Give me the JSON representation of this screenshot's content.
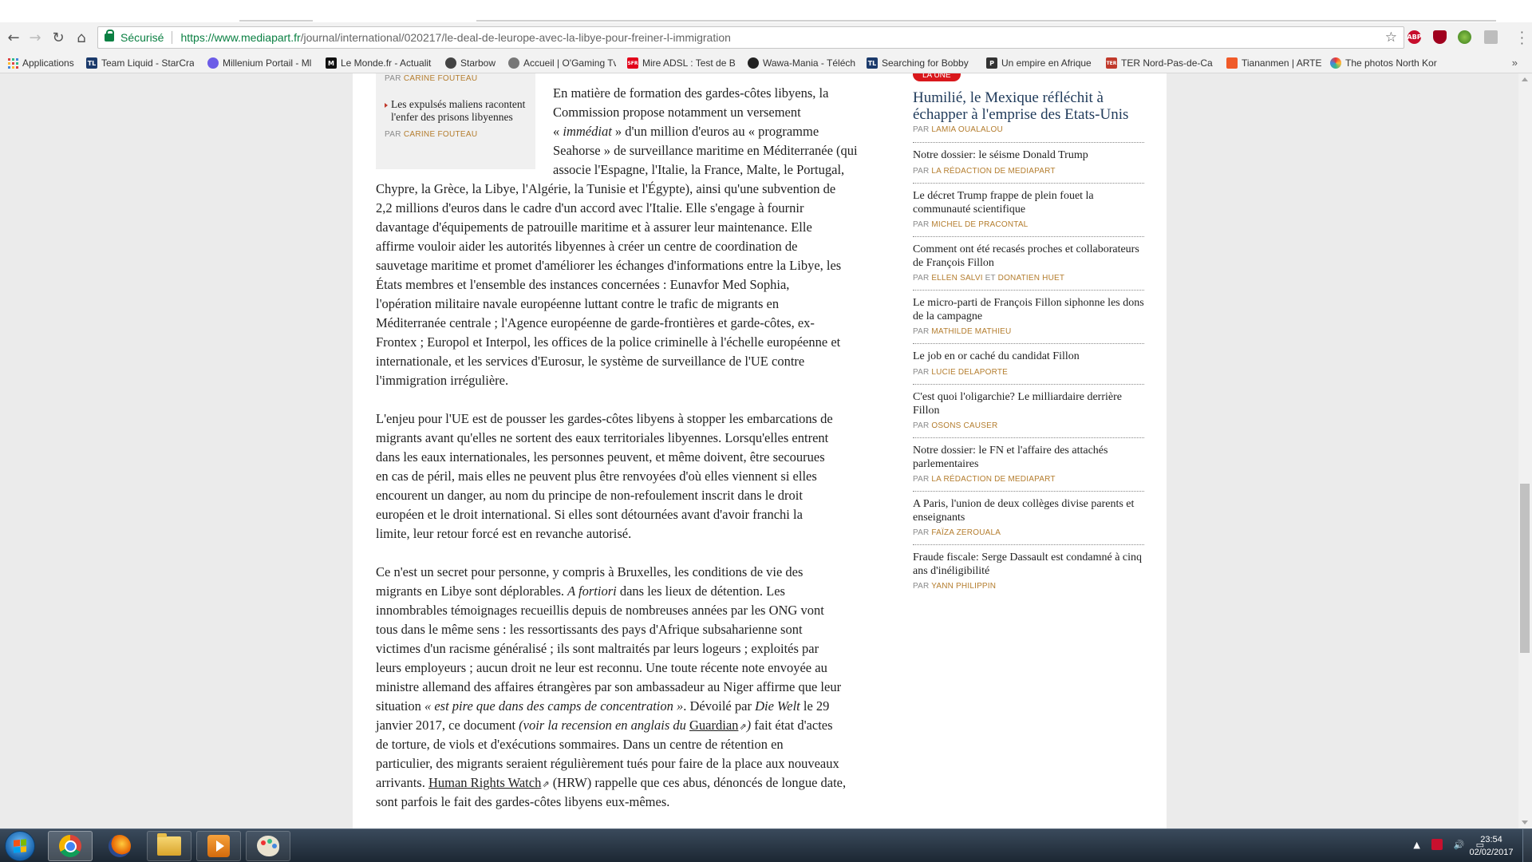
{
  "browser": {
    "secure_label": "Sécurisé",
    "url_host": "https://www.mediapart.fr",
    "url_path": "/journal/international/020217/le-deal-de-leurope-avec-la-libye-pour-freiner-l-immigration",
    "bookmarks": [
      {
        "label": "Applications",
        "icon": "apps-grid-icon",
        "color": "#555555"
      },
      {
        "label": "Team Liquid - StarCra",
        "icon": "tl-icon",
        "color": "#1b3a6b"
      },
      {
        "label": "Millenium Portail - Ml",
        "icon": "millenium-icon",
        "color": "#6c5ce7"
      },
      {
        "label": "Le Monde.fr - Actualit",
        "icon": "lemonde-icon",
        "color": "#111111"
      },
      {
        "label": "Starbow",
        "icon": "starbow-icon",
        "color": "#444444"
      },
      {
        "label": "Accueil | O'Gaming Tv",
        "icon": "ogaming-icon",
        "color": "#777777"
      },
      {
        "label": "Mire ADSL : Test de B",
        "icon": "sfr-icon",
        "color": "#e2001a"
      },
      {
        "label": "Wawa-Mania - Téléch",
        "icon": "wawa-icon",
        "color": "#222222"
      },
      {
        "label": "Searching for Bobby",
        "icon": "tl-icon",
        "color": "#1b3a6b"
      },
      {
        "label": "Un empire en Afrique",
        "icon": "page-icon",
        "color": "#333333"
      },
      {
        "label": "TER Nord-Pas-de-Cal",
        "icon": "ter-icon",
        "color": "#c0392b"
      },
      {
        "label": "Tiananmen | ARTE",
        "icon": "arte-icon",
        "color": "#f05a28"
      },
      {
        "label": "The photos North Kor",
        "icon": "photos-icon",
        "color": "#3c8dde"
      }
    ],
    "more_bookmarks": "»",
    "extensions": [
      {
        "name": "adblock-icon",
        "text": "ABP",
        "color": "#c70d2c"
      },
      {
        "name": "ublock-icon",
        "text": "",
        "color": "#a0001e"
      },
      {
        "name": "globe-ext-icon",
        "text": "",
        "color": "#5aa02c"
      },
      {
        "name": "pdf-ext-icon",
        "text": "",
        "color": "#b8b8b8"
      }
    ]
  },
  "related": {
    "top_by": "PAR",
    "top_author": "CARINE FOUTEAU",
    "title": "Les expulsés maliens racontent l'enfer des prisons libyennes",
    "by": "PAR",
    "author": "CARINE FOUTEAU"
  },
  "article": {
    "p1": [
      "En matière de formation des gardes-côtes libyens, la",
      "Commission propose notamment un versement",
      [
        "« ",
        "immédiat",
        " » d'un million d'euros au « programme"
      ],
      "Seahorse » de surveillance maritime en Méditerranée (qui",
      "associe l'Espagne, l'Italie, la France, Malte, le Portugal,",
      "Chypre, la Grèce, la Libye, l'Algérie, la Tunisie et l'Égypte), ainsi qu'une subvention de",
      "2,2 millions d'euros dans le cadre d'un accord avec l'Italie. Elle s'engage à fournir",
      "davantage d'équipements de patrouille maritime et à assurer leur maintenance. Elle",
      "affirme vouloir aider les autorités libyennes à créer un centre de coordination de",
      "sauvetage maritime et promet d'améliorer les échanges d'informations entre la Libye, les",
      "États membres et l'ensemble des instances concernées : Eunavfor Med Sophia,",
      "l'opération militaire navale européenne luttant contre le trafic de migrants en",
      "Méditerranée centrale ; l'Agence européenne de garde-frontières et garde-côtes, ex-",
      "Frontex ; Europol et Interpol, les offices de la police criminelle à l'échelle européenne et",
      "internationale, et les services d'Eurosur, le système de surveillance de l'UE contre",
      "l'immigration irrégulière."
    ],
    "p2": [
      "L'enjeu pour l'UE est de pousser les gardes-côtes libyens à stopper les embarcations de",
      "migrants avant qu'elles ne sortent des eaux territoriales libyennes. Lorsqu'elles entrent",
      "dans les eaux internationales, les personnes peuvent, et même doivent, être secourues",
      "en cas de péril, mais elles ne peuvent plus être renvoyées d'où elles viennent si elles",
      "encourent un danger, au nom du principe de non-refoulement inscrit dans le droit",
      "européen et le droit international. Si elles sont détournées avant d'avoir franchi la",
      "limite, leur retour forcé est en revanche autorisé."
    ],
    "p3": {
      "l1": "Ce n'est un secret pour personne, y compris à Bruxelles, les conditions de vie des",
      "l2a": "migrants en Libye sont déplorables. ",
      "l2b": "A fortiori",
      "l2c": " dans les lieux de détention. Les",
      "l3": "innombrables témoignages recueillis depuis de nombreuses années par les ONG vont",
      "l4": "tous dans le même sens : les ressortissants des pays d'Afrique subsaharienne sont",
      "l5": "victimes d'un racisme généralisé ; ils sont maltraités par leurs logeurs ; exploités par",
      "l6": "leurs employeurs ; aucun droit ne leur est reconnu. Une toute récente note envoyée au",
      "l7": "ministre allemand des affaires étrangères par son ambassadeur au Niger affirme que leur",
      "l8a": "situation ",
      "l8b": "« est pire que dans des camps de concentration »",
      "l8c": ". Dévoilé par ",
      "l8d": "Die Welt",
      "l8e": " le 29",
      "l9a": "janvier 2017, ce document ",
      "l9b": "(voir la recension en anglais du ",
      "l9c": "Guardian",
      "l9d": ")",
      "l9e": " fait état d'actes",
      "l10": "de torture, de viols et d'exécutions sommaires. Dans un centre de rétention en",
      "l11": "particulier, des migrants seraient régulièrement tués pour faire de la place aux nouveaux",
      "l12a": "arrivants. ",
      "l12b": "Human Rights Watch",
      "l12c": " (HRW) rappelle que ces abus, dénoncés de longue date,",
      "l13": "sont parfois le fait des gardes-côtes libyens eux-mêmes."
    }
  },
  "sidebar": {
    "badge": "LA UNE",
    "lead_title": "Humilié, le Mexique réfléchit à échapper à l'emprise des Etats-Unis",
    "lead_by": "PAR",
    "lead_author": "LAMIA OUALALOU",
    "items": [
      {
        "title": "Notre dossier: le séisme Donald Trump",
        "by": "PAR",
        "author": "LA RÉDACTION DE MEDIAPART"
      },
      {
        "title": "Le décret Trump frappe de plein fouet la communauté scientifique",
        "by": "PAR",
        "author": "MICHEL DE PRACONTAL"
      },
      {
        "title": "Comment ont été recasés proches et collaborateurs de François Fillon",
        "by": "PAR",
        "author": "ELLEN SALVI",
        "and": "ET",
        "author2": "DONATIEN HUET"
      },
      {
        "title": "Le micro-parti de François Fillon siphonne les dons de la campagne",
        "by": "PAR",
        "author": "MATHILDE MATHIEU"
      },
      {
        "title": "Le job en or caché du candidat Fillon",
        "by": "PAR",
        "author": "LUCIE DELAPORTE"
      },
      {
        "title": "C'est quoi l'oligarchie? Le milliardaire derrière Fillon",
        "by": "PAR",
        "author": "OSONS CAUSER"
      },
      {
        "title": "Notre dossier: le FN et l'affaire des attachés parlementaires",
        "by": "PAR",
        "author": "LA RÉDACTION DE MEDIAPART"
      },
      {
        "title": "A Paris, l'union de deux collèges divise parents et enseignants",
        "by": "PAR",
        "author": "FAÏZA ZEROUALA"
      },
      {
        "title": "Fraude fiscale: Serge Dassault est condamné à cinq ans d'inéligibilité",
        "by": "PAR",
        "author": "YANN PHILIPPIN"
      }
    ]
  },
  "taskbar": {
    "time": "23:54",
    "date": "02/02/2017"
  },
  "colors": {
    "accent_red": "#d9181c",
    "author_gold": "#b47d2e",
    "secure_green": "#0b8043"
  }
}
